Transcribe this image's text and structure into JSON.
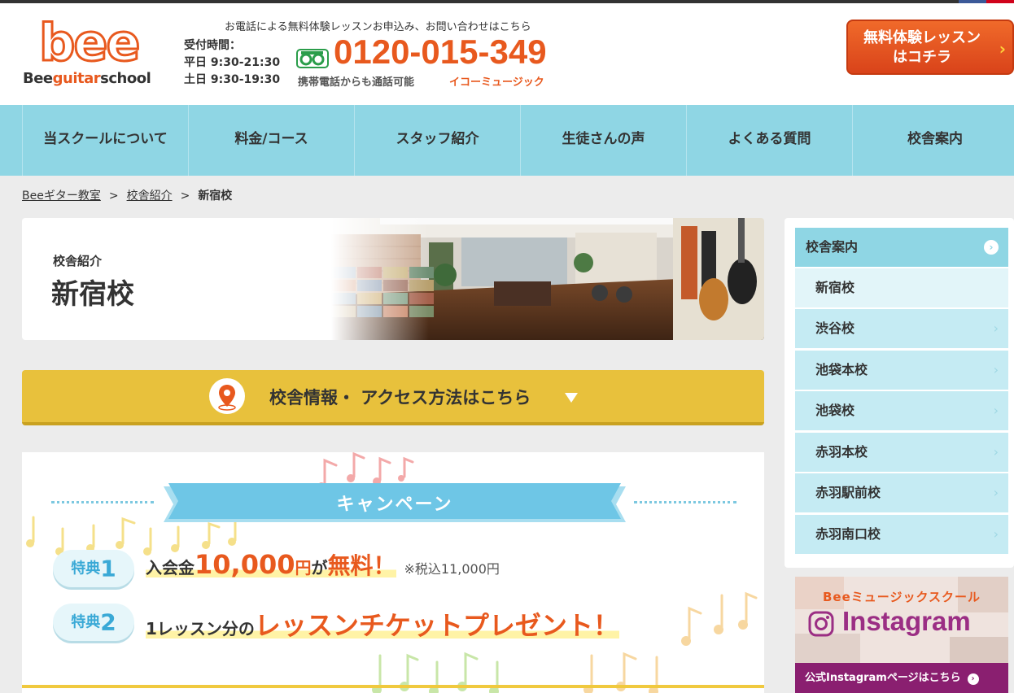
{
  "header": {
    "logo_main": "bee",
    "logo_sub_part1": "Bee",
    "logo_sub_part2": "guitar",
    "logo_sub_part3": "school",
    "tel_note": "お電話による無料体験レッスンお申込み、お問い合わせはこちら",
    "hours_label": "受付時間：",
    "hours_weekday": "平日 9:30-21:30",
    "hours_saturday": "土日 9:30-19:30",
    "tel_number": "0120-015-349",
    "mobile_note": "携帯電話からも通話可能",
    "company_note": "イコーミュージック",
    "trial_line1": "無料体験レッスン",
    "trial_line2": "はコチラ",
    "trial_arrow": "›"
  },
  "nav": {
    "items": [
      {
        "label": "当スクールについて"
      },
      {
        "label": "料金/コース"
      },
      {
        "label": "スタッフ紹介"
      },
      {
        "label": "生徒さんの声"
      },
      {
        "label": "よくある質問"
      },
      {
        "label": "校舎案内"
      }
    ]
  },
  "breadcrumb": {
    "items": [
      "Beeギター教室",
      "校舎紹介",
      "新宿校"
    ],
    "separator": ">"
  },
  "hero": {
    "subtitle": "校舎紹介",
    "title": "新宿校"
  },
  "access": {
    "label": "校舎情報・ アクセス方法はこちら"
  },
  "campaign": {
    "title": "キャンペーン",
    "perks": [
      {
        "badge_text": "特典",
        "badge_num": "1",
        "p1": "入会金",
        "p2": "10,000",
        "p3": "円",
        "p4": "が",
        "p5": "無料！",
        "note": "※税込11,000円"
      },
      {
        "badge_text": "特典",
        "badge_num": "2",
        "p1": "1レッスン分の",
        "p2": "レッスンチケットプレゼント！"
      }
    ]
  },
  "sidebar": {
    "heading": "校舎案内",
    "heading_icon": "›",
    "chevron": "›",
    "items": [
      {
        "label": "新宿校"
      },
      {
        "label": "渋谷校"
      },
      {
        "label": "池袋本校"
      },
      {
        "label": "池袋校"
      },
      {
        "label": "赤羽本校"
      },
      {
        "label": "赤羽駅前校"
      },
      {
        "label": "赤羽南口校"
      }
    ]
  },
  "instagram": {
    "top_text": "Beeミュージックスクール",
    "word": "Instagram",
    "link_text": "公式Instagramページはこちら",
    "link_icon": "›"
  },
  "colors": {
    "accent_orange": "#e8591e",
    "nav_blue": "#8fd6e4",
    "access_yellow": "#e8c13c",
    "insta_purple": "#8a1f70"
  },
  "icons": {
    "freedial": "freedial-icon",
    "map_pin": "map-pin-icon",
    "instagram": "instagram-icon"
  }
}
